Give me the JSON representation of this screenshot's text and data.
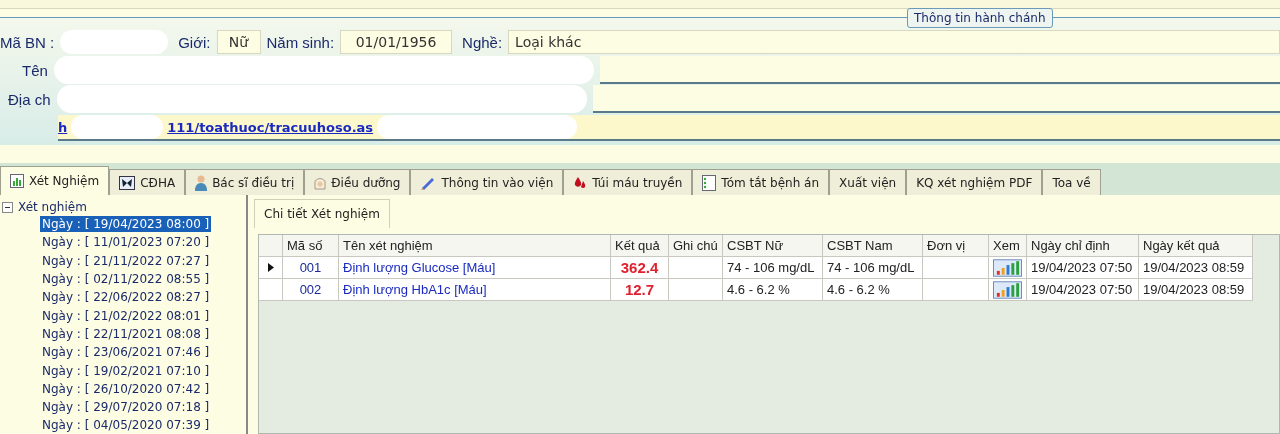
{
  "admin_group": {
    "legend": "Thông tin hành chánh",
    "patient_id_label": "Mã BN :",
    "gender_label": "Giới:",
    "gender": "Nữ",
    "birth_label": "Năm sinh:",
    "birth": "01/01/1956",
    "job_label": "Nghề:",
    "job": "Loại khác",
    "name_label": "Tên",
    "address_label": "Địa ch",
    "link_prefix": "h",
    "link": "111/toathuoc/tracuuhoso.as"
  },
  "tabs": [
    {
      "label": "Xét Nghiệm",
      "selected": true
    },
    {
      "label": "CĐHA",
      "selected": false
    },
    {
      "label": "Bác sĩ điều trị",
      "selected": false
    },
    {
      "label": "Điều dưỡng",
      "selected": false
    },
    {
      "label": "Thông tin vào viện",
      "selected": false
    },
    {
      "label": "Túi máu truyền",
      "selected": false
    },
    {
      "label": "Tóm tắt bệnh án",
      "selected": false
    },
    {
      "label": "Xuất viện",
      "selected": false
    },
    {
      "label": "KQ xét nghiệm PDF",
      "selected": false
    },
    {
      "label": "Toa về",
      "selected": false
    }
  ],
  "tree": {
    "label": "Xét nghiệm",
    "expanded": true,
    "children": [
      {
        "label": "Ngày : [ 19/04/2023 08:00 ]",
        "selected": true
      },
      {
        "label": "Ngày : [ 11/01/2023 07:20 ]",
        "selected": false
      },
      {
        "label": "Ngày : [ 21/11/2022 07:27 ]",
        "selected": false
      },
      {
        "label": "Ngày : [ 02/11/2022 08:55 ]",
        "selected": false
      },
      {
        "label": "Ngày : [ 22/06/2022 08:27 ]",
        "selected": false
      },
      {
        "label": "Ngày : [ 21/02/2022 08:01 ]",
        "selected": false
      },
      {
        "label": "Ngày : [ 22/11/2021 08:08 ]",
        "selected": false
      },
      {
        "label": "Ngày : [ 23/06/2021 07:46 ]",
        "selected": false
      },
      {
        "label": "Ngày : [ 19/02/2021 07:10 ]",
        "selected": false
      },
      {
        "label": "Ngày : [ 26/10/2020 07:42 ]",
        "selected": false
      },
      {
        "label": "Ngày : [ 29/07/2020 07:18 ]",
        "selected": false
      },
      {
        "label": "Ngày : [ 04/05/2020 07:39 ]",
        "selected": false
      }
    ]
  },
  "detail_tab": "Chi tiết Xét nghiệm",
  "table": {
    "columns": [
      "Mã số",
      "Tên xét nghiệm",
      "Kết quả",
      "Ghi chú",
      "CSBT Nữ",
      "CSBT Nam",
      "Đơn vị",
      "Xem",
      "Ngày chỉ định",
      "Ngày kết quả"
    ],
    "rows": [
      {
        "selected": true,
        "code": "001",
        "name": "Định lượng Glucose [Máu]",
        "result": "362.4",
        "female_range": "74 - 106 mg/dL",
        "male_range": "74 - 106 mg/dL",
        "ordered": "19/04/2023 07:50",
        "resulted": "19/04/2023 08:59"
      },
      {
        "selected": false,
        "code": "002",
        "name": "Định lượng HbA1c [Máu]",
        "result": "12.7",
        "female_range": "4.6 - 6.2 %",
        "male_range": "4.6 - 6.2 %",
        "ordered": "19/04/2023 07:50",
        "resulted": "19/04/2023 08:59"
      }
    ]
  }
}
